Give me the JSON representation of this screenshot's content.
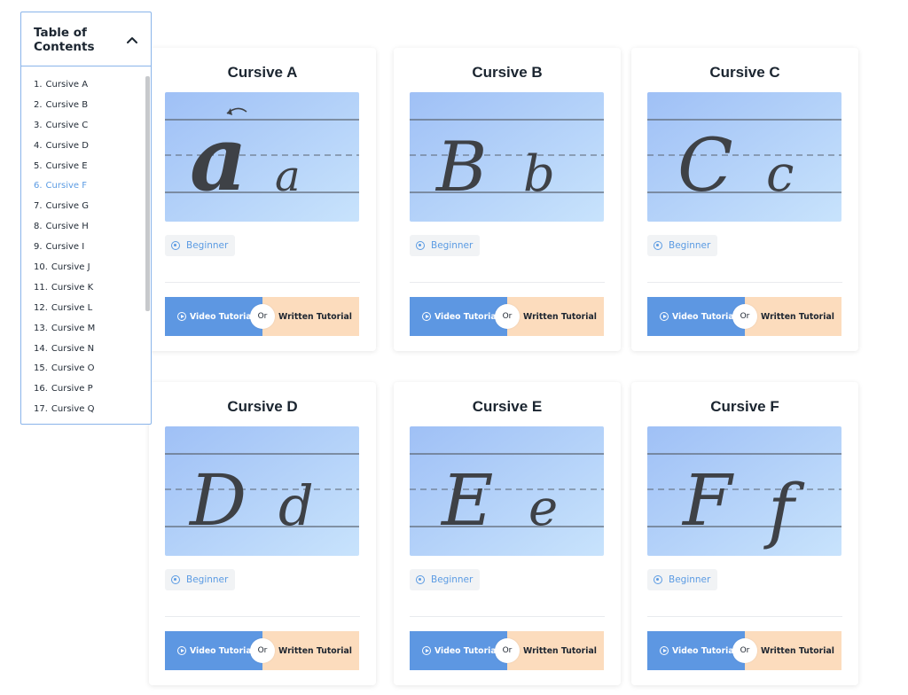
{
  "toc": {
    "title": "Table of Contents",
    "items": [
      {
        "num": "1.",
        "label": "Cursive A"
      },
      {
        "num": "2.",
        "label": "Cursive B"
      },
      {
        "num": "3.",
        "label": "Cursive C"
      },
      {
        "num": "4.",
        "label": "Cursive D"
      },
      {
        "num": "5.",
        "label": "Cursive E"
      },
      {
        "num": "6.",
        "label": "Cursive F"
      },
      {
        "num": "7.",
        "label": "Cursive G"
      },
      {
        "num": "8.",
        "label": "Cursive H"
      },
      {
        "num": "9.",
        "label": "Cursive I"
      },
      {
        "num": "10.",
        "label": "Cursive J"
      },
      {
        "num": "11.",
        "label": "Cursive K"
      },
      {
        "num": "12.",
        "label": "Cursive L"
      },
      {
        "num": "13.",
        "label": "Cursive M"
      },
      {
        "num": "14.",
        "label": "Cursive N"
      },
      {
        "num": "15.",
        "label": "Cursive O"
      },
      {
        "num": "16.",
        "label": "Cursive P"
      },
      {
        "num": "17.",
        "label": "Cursive Q"
      }
    ],
    "active_index": 5,
    "collapse_icon": "chevron-up-icon"
  },
  "buttons": {
    "video": "Video Tutorial",
    "or": "Or",
    "written": "Written Tutorial"
  },
  "cards": [
    {
      "title": "Cursive A",
      "upper": "a",
      "lower": "a",
      "level": "Beginner"
    },
    {
      "title": "Cursive B",
      "upper": "B",
      "lower": "b",
      "level": "Beginner"
    },
    {
      "title": "Cursive C",
      "upper": "C",
      "lower": "c",
      "level": "Beginner"
    },
    {
      "title": "Cursive D",
      "upper": "D",
      "lower": "d",
      "level": "Beginner"
    },
    {
      "title": "Cursive E",
      "upper": "E",
      "lower": "e",
      "level": "Beginner"
    },
    {
      "title": "Cursive F",
      "upper": "F",
      "lower": "f",
      "level": "Beginner"
    }
  ],
  "colors": {
    "accent_blue": "#5d97e2",
    "written_bg": "#fcdcbd",
    "toc_border": "#8ab4ea",
    "active_link": "#5b9be3"
  }
}
